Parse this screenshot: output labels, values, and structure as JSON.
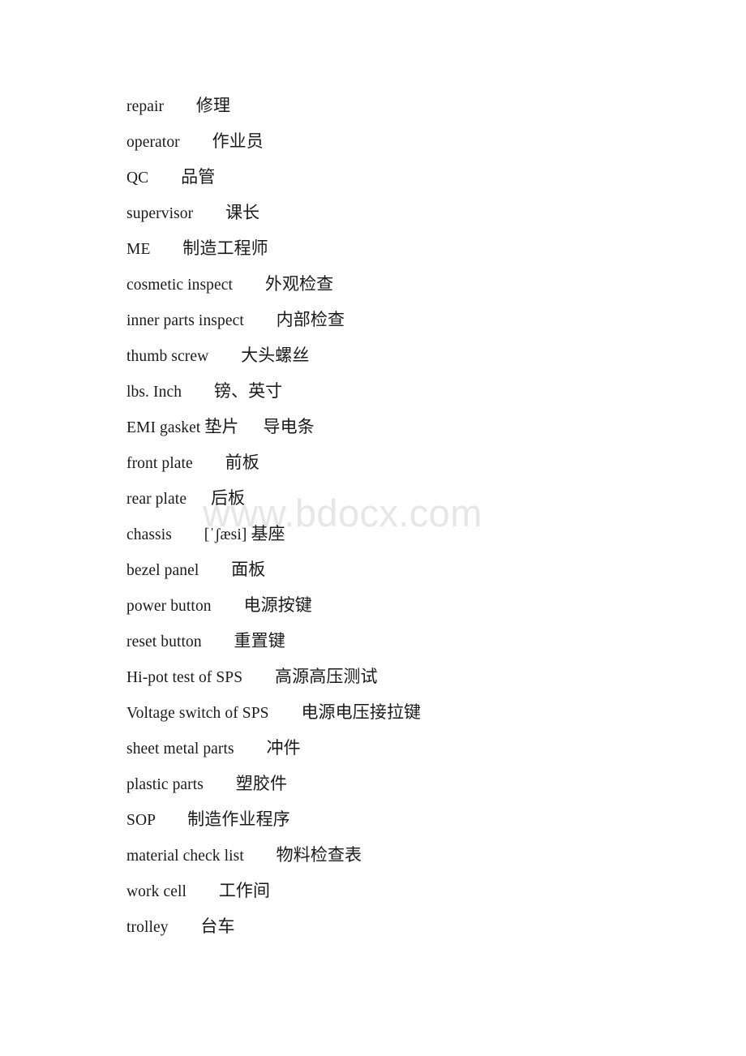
{
  "document": {
    "type": "bilingual-glossary",
    "page_background": "#ffffff",
    "text_color": "#1a1a1a"
  },
  "watermark": {
    "text": "www.bdocx.com",
    "color": "#e6e6e6"
  },
  "glossary": {
    "entries": [
      {
        "term": "repair",
        "gap": "        ",
        "gloss": "修理"
      },
      {
        "term": "operator",
        "gap": "        ",
        "gloss": "作业员"
      },
      {
        "term": "QC",
        "gap": "        ",
        "gloss": "品管"
      },
      {
        "term": "supervisor",
        "gap": "        ",
        "gloss": "课长"
      },
      {
        "term": "ME",
        "gap": "        ",
        "gloss": "制造工程师"
      },
      {
        "term": "cosmetic inspect",
        "gap": "        ",
        "gloss": "外观检查"
      },
      {
        "term": "inner parts inspect",
        "gap": "        ",
        "gloss": "内部检查"
      },
      {
        "term": "thumb screw",
        "gap": "        ",
        "gloss": "大头螺丝"
      },
      {
        "term": "lbs. Inch",
        "gap": "        ",
        "gloss": "镑、英寸"
      },
      {
        "term": "EMI gasket 垫片",
        "gap": "      ",
        "gloss": "导电条"
      },
      {
        "term": "front plate",
        "gap": "        ",
        "gloss": "前板"
      },
      {
        "term": "rear plate",
        "gap": "      ",
        "gloss": "后板"
      },
      {
        "term": "chassis",
        "gap": "        ",
        "gloss": "[ˈʃæsi] 基座"
      },
      {
        "term": "bezel panel",
        "gap": "        ",
        "gloss": "面板"
      },
      {
        "term": "power button",
        "gap": "        ",
        "gloss": "电源按键"
      },
      {
        "term": "reset button",
        "gap": "        ",
        "gloss": "重置键"
      },
      {
        "term": "Hi-pot test of SPS",
        "gap": "        ",
        "gloss": "高源高压测试"
      },
      {
        "term": "Voltage switch of SPS",
        "gap": "        ",
        "gloss": "电源电压接拉键"
      },
      {
        "term": "sheet metal parts",
        "gap": "        ",
        "gloss": "冲件"
      },
      {
        "term": "plastic parts",
        "gap": "        ",
        "gloss": "塑胶件"
      },
      {
        "term": "SOP",
        "gap": "        ",
        "gloss": "制造作业程序"
      },
      {
        "term": "material check list",
        "gap": "        ",
        "gloss": "物料检查表"
      },
      {
        "term": "work cell",
        "gap": "        ",
        "gloss": "工作间"
      },
      {
        "term": "trolley",
        "gap": "        ",
        "gloss": "台车"
      }
    ]
  }
}
